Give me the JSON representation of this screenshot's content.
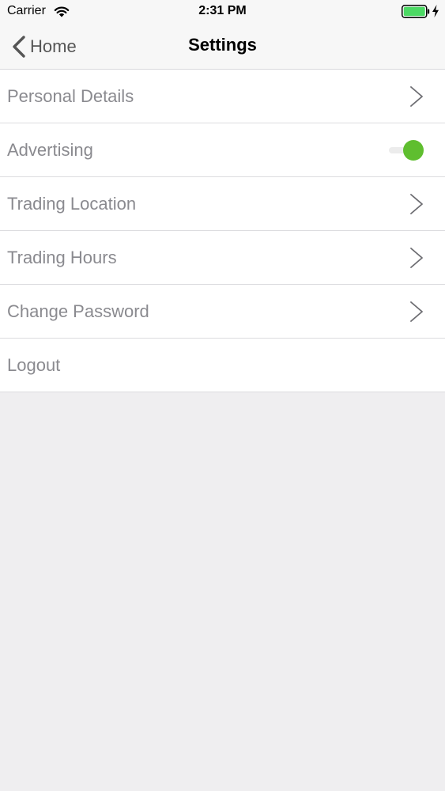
{
  "status_bar": {
    "carrier": "Carrier",
    "time": "2:31 PM",
    "wifi_icon": "wifi-icon",
    "battery_icon": "battery-icon",
    "charging_icon": "bolt-icon"
  },
  "nav": {
    "back_label": "Home",
    "title": "Settings"
  },
  "settings": {
    "items": [
      {
        "label": "Personal Details",
        "accessory": "chevron"
      },
      {
        "label": "Advertising",
        "accessory": "toggle",
        "toggle_on": true
      },
      {
        "label": "Trading Location",
        "accessory": "chevron"
      },
      {
        "label": "Trading Hours",
        "accessory": "chevron"
      },
      {
        "label": "Change Password",
        "accessory": "chevron"
      },
      {
        "label": "Logout",
        "accessory": "none"
      }
    ]
  },
  "colors": {
    "toggle_on": "#5fbe2f",
    "battery": "#4cd964",
    "background": "#efeef0",
    "label_text": "#8a8a8f"
  }
}
